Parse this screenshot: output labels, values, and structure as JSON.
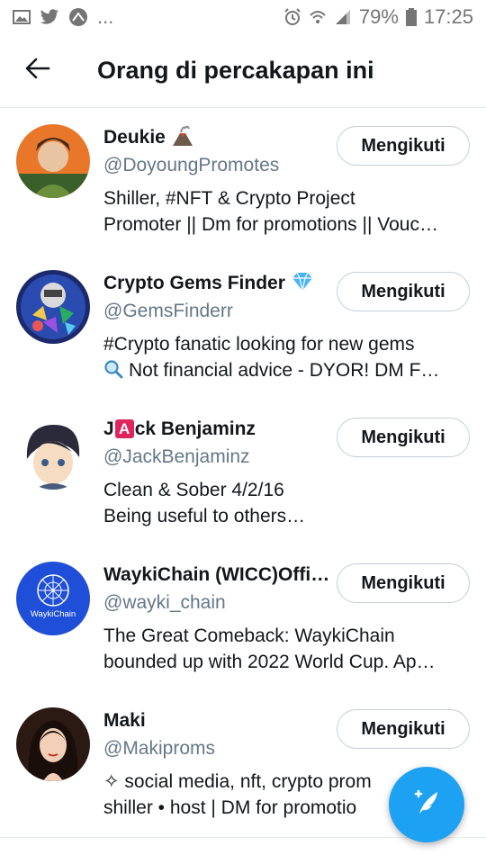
{
  "status_bar": {
    "ellipsis": "...",
    "battery": "79%",
    "time": "17:25"
  },
  "header": {
    "title": "Orang di percakapan ini"
  },
  "colors": {
    "accent": "#1da1f2",
    "secondary_text": "#657786",
    "border": "#e6ecf0"
  },
  "users": [
    {
      "name": "Deukie",
      "handle": "@DoyoungPromotes",
      "bio_line1": "Shiller, #NFT & Crypto Project",
      "bio_line2": "Promoter || Dm for promotions || Vouc…",
      "button": "Mengikuti",
      "name_icon": "volcano-icon"
    },
    {
      "name": "Crypto Gems Finder",
      "handle": "@GemsFinderr",
      "bio_line1": "#Crypto fanatic looking for new gems",
      "bio_line2": "Not financial advice - DYOR! DM F…",
      "button": "Mengikuti",
      "name_icon": "gem-icon"
    },
    {
      "name_prefix": "J",
      "name_badge": "A",
      "name_suffix": "ck Benjaminz",
      "handle": "@JackBenjaminz",
      "bio_line1": "Clean & Sober 4/2/16",
      "bio_line2": "Being useful to others…",
      "button": "Mengikuti"
    },
    {
      "name": "WaykiChain (WICC)Offici…",
      "handle": "@wayki_chain",
      "bio_line1": "The Great Comeback: WaykiChain",
      "bio_line2": "bounded up with 2022 World Cup.  Ap…",
      "button": "Mengikuti",
      "avatar_text": "WaykiChain"
    },
    {
      "name": "Maki",
      "handle": "@Makiproms",
      "bio_line1": "✧ social media, nft, crypto prom",
      "bio_line2": "shiller • host | DM for promotio",
      "button": "Mengikuti"
    }
  ],
  "fab": {
    "icon": "compose-tweet-icon"
  }
}
